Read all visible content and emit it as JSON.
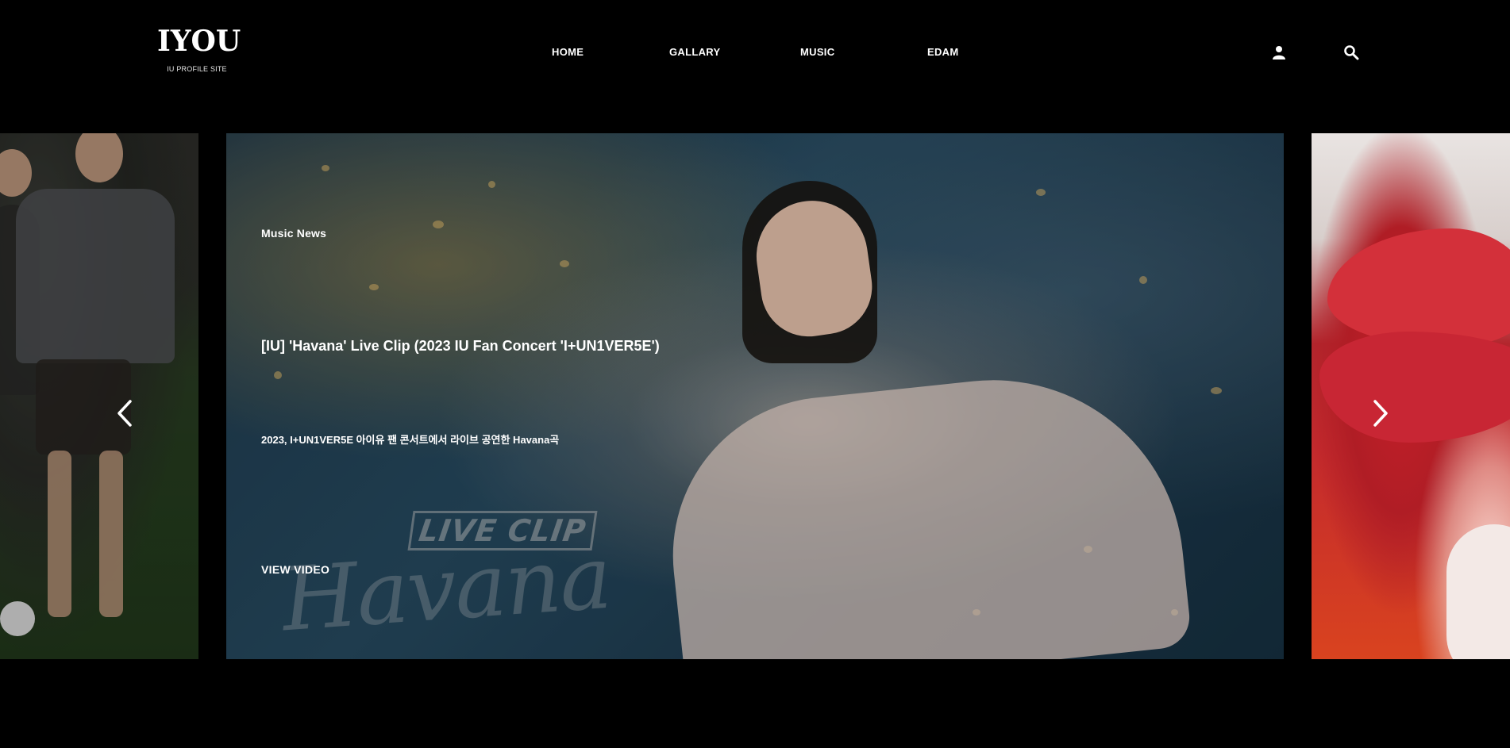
{
  "header": {
    "logo_title": "IYOU",
    "logo_subtitle": "IU PROFILE SITE"
  },
  "nav": {
    "items": [
      {
        "label": "HOME"
      },
      {
        "label": "GALLARY"
      },
      {
        "label": "MUSIC"
      },
      {
        "label": "EDAM"
      }
    ]
  },
  "header_icons": {
    "user": "user-icon",
    "search": "search-icon"
  },
  "slider": {
    "active_slide": {
      "category": "Music News",
      "headline": "[IU] 'Havana' Live Clip (2023 IU Fan Concert 'I+UN1VER5E')",
      "description": "2023, I+UN1VER5E 아이유 팬 콘서트에서 라이브 공연한 Havana곡",
      "cta_label": "VIEW VIDEO",
      "image_badge": "LIVE CLIP",
      "image_script_text": "Havana"
    },
    "prev_icon": "chevron-left-icon",
    "next_icon": "chevron-right-icon"
  },
  "colors": {
    "background": "#000000",
    "text": "#ffffff"
  }
}
